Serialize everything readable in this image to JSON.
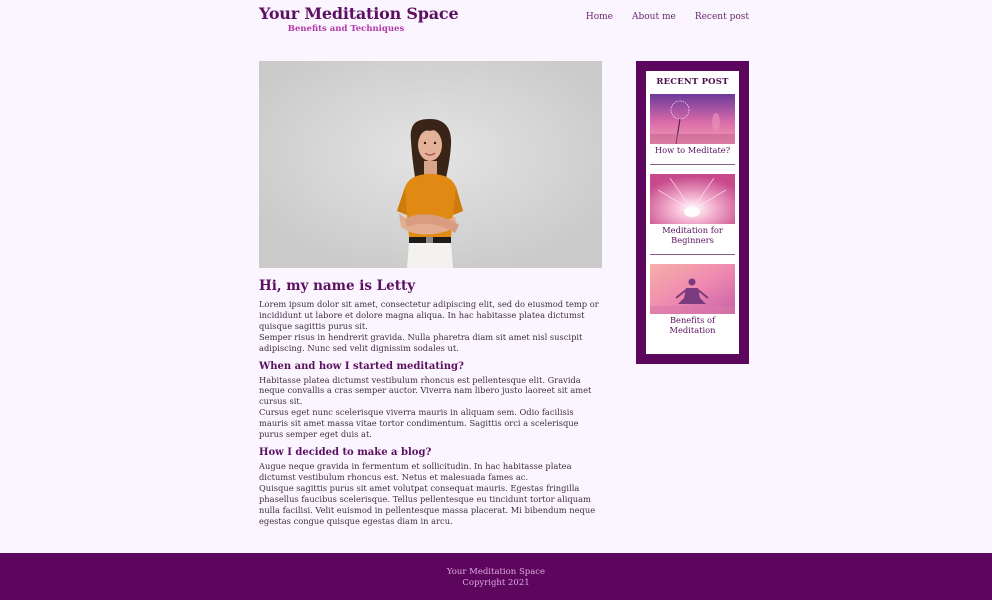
{
  "header": {
    "title": "Your Meditation Space",
    "subtitle": "Benefits and Techniques",
    "nav": [
      "Home",
      "About me",
      "Recent post"
    ]
  },
  "article": {
    "heading": "Hi, my name is Letty",
    "intro_p1": "Lorem ipsum dolor sit amet, consectetur adipiscing elit, sed do eiusmod temp or incididunt ut labore et dolore magna aliqua. In hac habitasse platea dictumst quisque sagittis purus sit.",
    "intro_p2": "Semper risus in hendrerit gravida. Nulla pharetra diam sit amet nisl suscipit adipiscing. Nunc sed velit dignissim sodales ut.",
    "section1_heading": "When and how I started meditating?",
    "section1_p1": "Habitasse platea dictumst vestibulum rhoncus est pellentesque elit. Gravida neque convallis a cras semper auctor. Viverra nam libero justo laoreet sit amet cursus sit.",
    "section1_p2": "Cursus eget nunc scelerisque viverra mauris in aliquam sem. Odio facilisis mauris sit amet massa vitae tortor condimentum. Sagittis orci a scelerisque purus semper eget duis at.",
    "section2_heading": "How I decided to make a blog?",
    "section2_p1": "Augue neque gravida in fermentum et sollicitudin. In hac habitasse platea dictumst vestibulum rhoncus est. Netus et malesuada fames ac.",
    "section2_p2": "Quisque sagittis purus sit amet volutpat consequat mauris. Egestas fringilla phasellus faucibus scelerisque. Tellus pellentesque eu tincidunt tortor aliquam nulla facilisi. Velit euismod in pellentesque massa placerat. Mi bibendum neque egestas congue quisque egestas diam in arcu."
  },
  "sidebar": {
    "title": "RECENT POST",
    "posts": [
      {
        "label": "How to Meditate?"
      },
      {
        "label": "Meditation for Beginners"
      },
      {
        "label": "Benefits of Meditation"
      }
    ]
  },
  "footer": {
    "line1": "Your Meditation Space",
    "line2": "Copyright 2021"
  },
  "colors": {
    "brand": "#5c065e",
    "accent": "#b43aa8",
    "background": "#faf5ff"
  }
}
